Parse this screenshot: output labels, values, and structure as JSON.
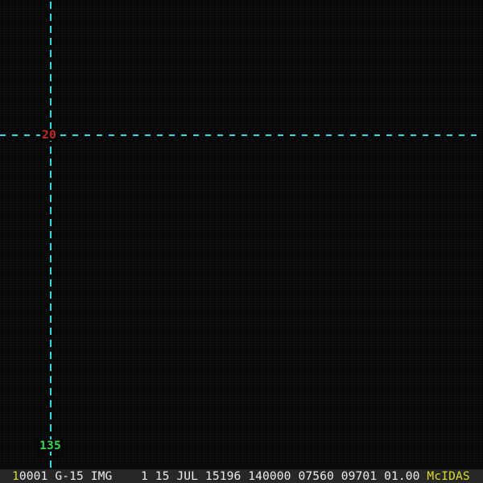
{
  "colors": {
    "bg": "#070707",
    "grid": "#2fd9e6",
    "lat": "#c62a22",
    "lon": "#36d64e",
    "bar-bg": "#272727",
    "bar-text": "#ededed",
    "bar-accent": "#dcdc28"
  },
  "crosshair": {
    "latitude_label": "20",
    "longitude_label": "135"
  },
  "status_bar": {
    "frame_number": "1",
    "info_text": "0001 G-15 IMG    1 15 JUL 15196 140000 07560 09701 01.00 ",
    "brand": "McIDAS"
  }
}
